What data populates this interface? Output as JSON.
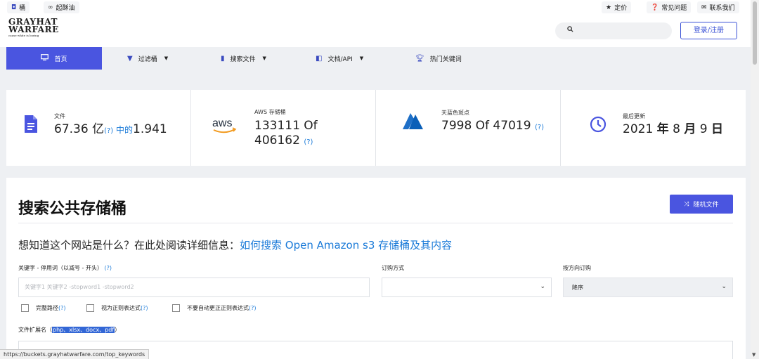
{
  "topbar": {
    "left_links": [
      {
        "icon": "bucket-icon",
        "label": "桶"
      },
      {
        "icon": "link-icon",
        "label": "起酥油"
      }
    ],
    "right_links": [
      {
        "icon": "star-icon",
        "label": "定价"
      },
      {
        "icon": "question-icon",
        "label": "常见问题"
      },
      {
        "icon": "mail-icon",
        "label": "联系我们"
      }
    ]
  },
  "header": {
    "logo_line1": "GRAYHAT",
    "logo_line2": "WARFARE",
    "logo_tagline": "cause white is boring",
    "search_placeholder": "",
    "login_label": "登录/注册"
  },
  "nav": {
    "items": [
      {
        "icon": "monitor-icon",
        "label": "首页",
        "active": true
      },
      {
        "icon": "filter-icon",
        "label": "过滤桶",
        "dropdown": true
      },
      {
        "icon": "file-icon",
        "label": "搜索文件",
        "dropdown": true
      },
      {
        "icon": "book-icon",
        "label": "文档/API",
        "dropdown": true
      },
      {
        "icon": "trophy-icon",
        "label": "热门关键词"
      }
    ]
  },
  "stats": {
    "files": {
      "label": "文件",
      "value": "67.36 亿",
      "q": "(?)",
      "mid": " 中的",
      "tail": "1.941"
    },
    "aws": {
      "label": "AWS 存储桶",
      "line1": "133111 Of",
      "line2": "406162",
      "q": "(?)"
    },
    "azure": {
      "label": "天蓝色斑点",
      "value": "7998 Of 47019",
      "q": "(?)"
    },
    "updated": {
      "label": "最后更新",
      "year": "2021",
      "y_unit": "年",
      "month": "8",
      "m_unit": "月",
      "day": "9",
      "d_unit": "日"
    }
  },
  "main": {
    "title": "搜索公共存储桶",
    "random_label": "随机文件",
    "question_text": "想知道这个网站是什么？在此处阅读详细信息：",
    "question_link": "如何搜索 Open Amazon s3 存储桶及其内容",
    "keywords_label": "关键字 - 停用词（以减号 - 开头）",
    "keywords_q": "(?)",
    "keywords_placeholder": "关键字1 关键字2 -stopword1 -stopword2",
    "order_label": "订购方式",
    "order_value": "",
    "direction_label": "按方向订购",
    "direction_value": "降序",
    "checkboxes": [
      {
        "label": "完整路径",
        "q": "(?)"
      },
      {
        "label": "视为正则表达式",
        "q": "(?)"
      },
      {
        "label": "不要自动更正正则表达式",
        "q": "(?)"
      }
    ],
    "ext_label_prefix": "文件扩展名（",
    "ext_value": "php、xlsx、docx、pdf",
    "ext_label_suffix": "）"
  },
  "statusbar": {
    "url": "https://buckets.grayhatwarfare.com/top_keywords"
  },
  "colors": {
    "accent": "#4a55e0",
    "link": "#1a7ad8",
    "aws_orange": "#f29a1f",
    "azure_blue": "#1e6fc7"
  }
}
